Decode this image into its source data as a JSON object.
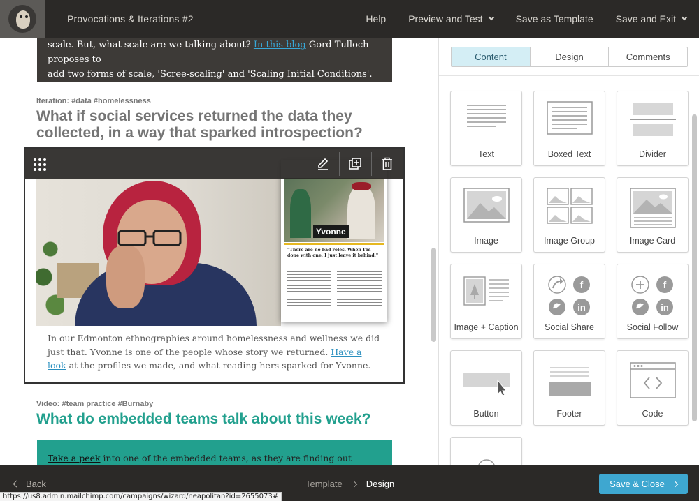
{
  "header": {
    "campaign_title": "Provocations & Iterations #2",
    "nav": {
      "help": "Help",
      "preview": "Preview and Test",
      "save_template": "Save as Template",
      "save_exit": "Save and Exit"
    }
  },
  "canvas": {
    "intro": {
      "text_before": "scale. But, what scale are we talking about? ",
      "link": "In this blog",
      "text_after": " Gord Tulloch proposes to",
      "line2": "add two forms of scale, 'Scree-scaling' and 'Scaling Initial Conditions'."
    },
    "iteration": {
      "tags": "Iteration: #data  #homelessness",
      "headline": "What if social services returned the data they collected, in a way that sparked introspection?",
      "magazine_name": "Yvonne",
      "magazine_quote": "\"There are no bad roles. When I'm done with one, I just leave it behind.\"",
      "text_before": "In our Edmonton ethnographies around homelessness and wellness we did just that. Yvonne is one of the people whose story we returned. ",
      "link": "Have a look",
      "text_after": " at the profiles we made, and what reading hers sparked for Yvonne."
    },
    "video": {
      "tags": "Video:  #team practice   #Burnaby",
      "headline": "What do embedded teams talk about this week?",
      "link": "Take a peek",
      "text_after": "  into one of the embedded teams, as they are finding out where there"
    }
  },
  "panel": {
    "tabs": [
      "Content",
      "Design",
      "Comments"
    ],
    "active_tab": "Content",
    "tiles": [
      {
        "label": "Text",
        "icon": "text-lines-icon"
      },
      {
        "label": "Boxed Text",
        "icon": "boxed-text-icon"
      },
      {
        "label": "Divider",
        "icon": "divider-icon"
      },
      {
        "label": "Image",
        "icon": "image-icon"
      },
      {
        "label": "Image Group",
        "icon": "image-group-icon"
      },
      {
        "label": "Image Card",
        "icon": "image-card-icon"
      },
      {
        "label": "Image + Caption",
        "icon": "image-caption-icon"
      },
      {
        "label": "Social Share",
        "icon": "social-share-icon"
      },
      {
        "label": "Social Follow",
        "icon": "social-follow-icon"
      },
      {
        "label": "Button",
        "icon": "button-icon"
      },
      {
        "label": "Footer",
        "icon": "footer-icon"
      },
      {
        "label": "Code",
        "icon": "code-icon"
      }
    ]
  },
  "footer": {
    "back": "Back",
    "step_template": "Template",
    "step_design": "Design",
    "save_close": "Save & Close"
  },
  "status_url": "https://us8.admin.mailchimp.com/campaigns/wizard/neapolitan?id=2655073#",
  "colors": {
    "topbar": "#2b2927",
    "accent_teal": "#22a08e",
    "accent_blue": "#3ea7d0",
    "active_tab": "#d4eef5"
  }
}
